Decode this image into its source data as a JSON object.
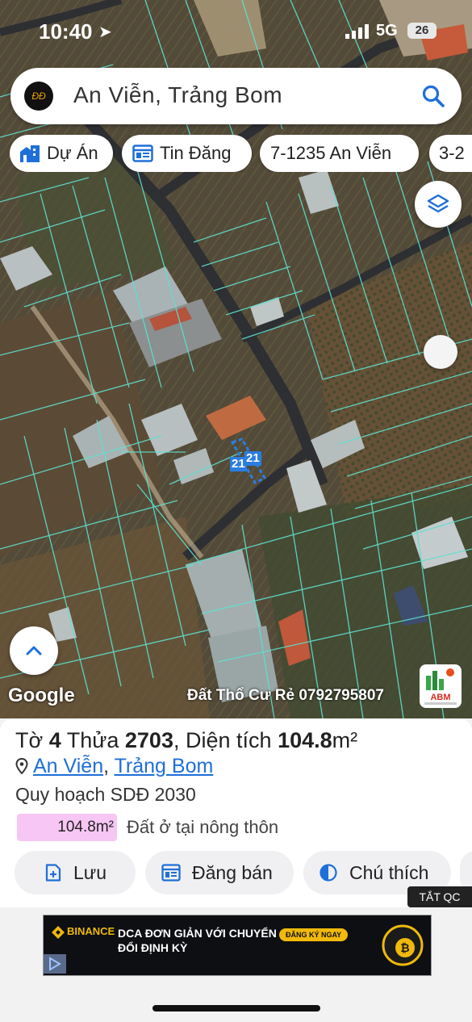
{
  "status_bar": {
    "time": "10:40",
    "network": "5G",
    "battery": "26"
  },
  "search": {
    "query": "An Viễn, Trảng Bom",
    "logo_text": "ĐĐ"
  },
  "chips": [
    {
      "label": "Dự Án",
      "icon": "building-icon"
    },
    {
      "label": "Tin Đăng",
      "icon": "listing-icon"
    },
    {
      "label": "7-1235 An Viễn"
    },
    {
      "label": "3-2"
    }
  ],
  "map": {
    "parcel_label_1": "21",
    "parcel_label_2": "21",
    "google_text": "Google",
    "watermark": "Đất Thổ Cư Rẻ 0792795807",
    "brand": "ABM"
  },
  "parcel": {
    "sheet_label": "Tờ",
    "sheet_no": "4",
    "plot_label": "Thửa",
    "plot_no": "2703",
    "area_label": "Diện tích",
    "area_value": "104.8",
    "area_unit": "m²",
    "commune": "An Viễn",
    "district": "Trảng Bom",
    "planning": "Quy hoạch SDĐ 2030",
    "badge_area": "104.8m²",
    "land_use": "Đất ở tại nông thôn",
    "badge_color": "#f7c6f4"
  },
  "actions": {
    "save": "Lưu",
    "post_sale": "Đăng bán",
    "legend": "Chú thích"
  },
  "ad": {
    "close_label": "TẮT QC",
    "brand": "BINANCE",
    "headline_1": "DCA ĐƠN GIẢN VỚI CHUYỂN",
    "headline_2": "ĐỔI ĐỊNH KỲ",
    "cta": "ĐĂNG KÝ NGAY"
  },
  "colors": {
    "accent": "#1e6fd9",
    "parcel_line": "#5ee0d0"
  }
}
